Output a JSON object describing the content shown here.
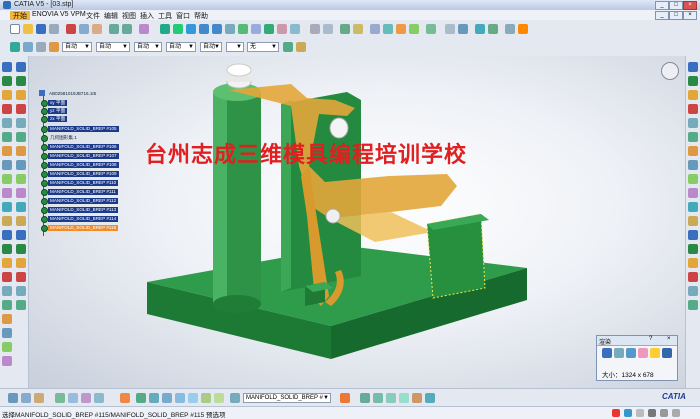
{
  "window": {
    "title": "CATIA V5 - [03.stp]"
  },
  "menu": [
    "开始",
    "ENOVIA V5 VPM",
    "文件",
    "编辑",
    "视图",
    "插入",
    "工具",
    "窗口",
    "帮助"
  ],
  "toolbar2": {
    "combo1": "自动",
    "combo2": "自动",
    "combo3": "自动",
    "combo4": "自动",
    "combo5": "自动",
    "combo6": "无"
  },
  "tree": {
    "root": "AB02581019JB716.1t5",
    "items": [
      {
        "label": "xy 平面",
        "style": "plain"
      },
      {
        "label": "yz 平面",
        "style": "plain"
      },
      {
        "label": "zx 平面",
        "style": "plain"
      },
      {
        "label": "MANIFOLD_SOLID_BREP #105",
        "style": "blue"
      },
      {
        "label": "几何图形集.1",
        "style": "plain"
      },
      {
        "label": "MANIFOLD_SOLID_BREP #106",
        "style": "blue"
      },
      {
        "label": "MANIFOLD_SOLID_BREP #107",
        "style": "blue"
      },
      {
        "label": "MANIFOLD_SOLID_BREP #108",
        "style": "blue"
      },
      {
        "label": "MANIFOLD_SOLID_BREP #109",
        "style": "blue"
      },
      {
        "label": "MANIFOLD_SOLID_BREP #110",
        "style": "blue"
      },
      {
        "label": "MANIFOLD_SOLID_BREP #111",
        "style": "blue"
      },
      {
        "label": "MANIFOLD_SOLID_BREP #112",
        "style": "blue"
      },
      {
        "label": "MANIFOLD_SOLID_BREP #113",
        "style": "blue"
      },
      {
        "label": "MANIFOLD_SOLID_BREP #114",
        "style": "blue"
      },
      {
        "label": "MANIFOLD_SOLID_BREP #115",
        "style": "selected"
      }
    ]
  },
  "watermark": "台州志成三维模具编程培训学校",
  "render_panel": {
    "title": "渲染",
    "size_label": "大小：1324 x 678"
  },
  "bottom": {
    "selector": "MANIFOLD_SOLID_BREP #"
  },
  "status": {
    "text": "选择MANIFOLD_SOLID_BREP #115/MANIFOLD_SOLID_BREP #115 预选项"
  },
  "catia_logo": "CATIA",
  "colors": {
    "model_green": "#1f8a3c",
    "bracket_orange": "#e3a63a",
    "tree_blue": "#1b3a8a",
    "tree_selected": "#f28c28",
    "watermark": "#e02020"
  }
}
